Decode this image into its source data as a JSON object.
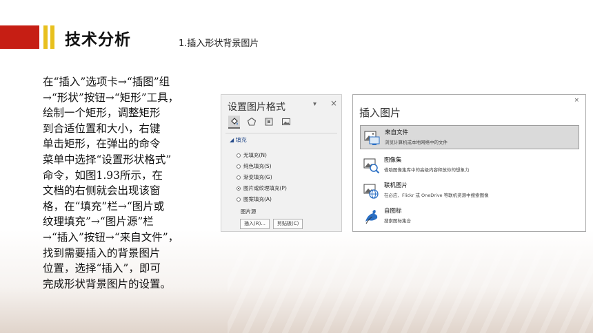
{
  "header": {
    "title": "技术分析",
    "subtitle": "1.插入形状背景图片"
  },
  "body_lines": [
    "在“插入”选项卡→“插图”组",
    "→“形状”按钮→“矩形”工具，",
    "绘制一个矩形，调整矩形",
    "到合适位置和大小，右键",
    "单击矩形，在弹出的命令",
    "菜单中选择“设置形状格式”",
    "命令，如图1.93所示，在",
    "文档的右侧就会出现该窗",
    "格，在“填充”栏→“图片或",
    "纹理填充”→“图片源”栏",
    "→“插入”按钮→“来自文件”，",
    "找到需要插入的背景图片",
    "位置，选择“插入”，即可",
    "完成形状背景图片的设置。"
  ],
  "format_pane": {
    "title": "设置图片格式",
    "dropdown_glyph": "▾",
    "close_glyph": "×",
    "icons": [
      "fill-line-icon",
      "effects-pentagon-icon",
      "size-properties-icon",
      "picture-icon"
    ],
    "section_label": "◢ 填充",
    "fill_options": [
      {
        "label": "无填充(N)",
        "selected": false
      },
      {
        "label": "纯色填充(S)",
        "selected": false
      },
      {
        "label": "渐变填充(G)",
        "selected": false
      },
      {
        "label": "图片或纹理填充(P)",
        "selected": true
      },
      {
        "label": "图案填充(A)",
        "selected": false
      }
    ],
    "picture_source_label": "图片源",
    "insert_button": "插入(R)...",
    "clipboard_button": "剪贴板(C)"
  },
  "insert_dialog": {
    "title": "插入图片",
    "close_glyph": "×",
    "options": [
      {
        "title": "来自文件",
        "desc": "浏览计算机或本地网络中的文件",
        "icon": "from-file-icon",
        "highlighted": true
      },
      {
        "title": "图像集",
        "desc": "借助图像集库中的高级内容释放你的想象力",
        "icon": "image-set-icon",
        "highlighted": false
      },
      {
        "title": "联机图片",
        "desc": "在必应、Flickr 或 OneDrive 等联机资源中搜索图像",
        "icon": "online-pictures-icon",
        "highlighted": false
      },
      {
        "title": "自图标",
        "desc": "搜索图标集合",
        "icon": "icons-bird-icon",
        "highlighted": false
      }
    ]
  },
  "colors": {
    "accent_red": "#c61e14",
    "accent_yellow": "#e8c01e",
    "pane_section_blue": "#244a8a",
    "icon_blue": "#2a6fc4"
  }
}
